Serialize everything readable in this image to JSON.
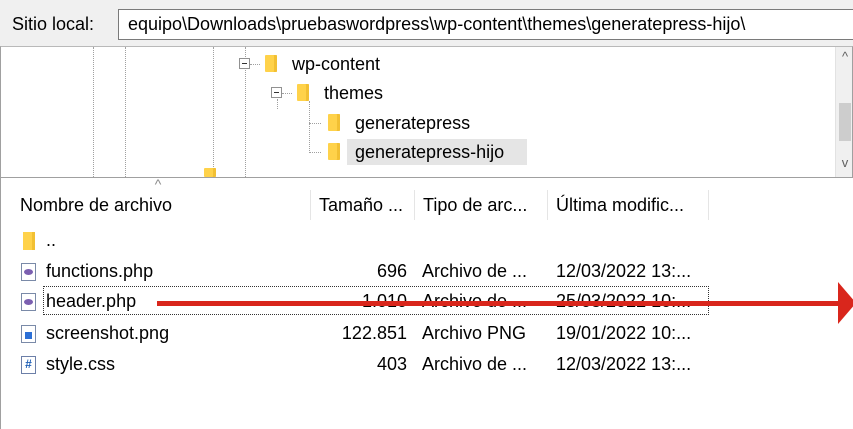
{
  "path_bar": {
    "label": "Sitio local:",
    "value": "equipo\\Downloads\\pruebaswordpress\\wp-content\\themes\\generatepress-hijo\\"
  },
  "tree": {
    "nodes": [
      {
        "label": "wp-content",
        "state": "expanded"
      },
      {
        "label": "themes",
        "state": "expanded"
      },
      {
        "label": "generatepress",
        "state": "leaf"
      },
      {
        "label": "generatepress-hijo",
        "state": "selected"
      }
    ],
    "scroll_up": "^",
    "scroll_down": "v"
  },
  "file_list": {
    "columns": [
      "Nombre de archivo",
      "Tamaño ...",
      "Tipo de arc...",
      "Última modific..."
    ],
    "sort_indicator": "^",
    "rows": [
      {
        "name": "..",
        "size": "",
        "type": "",
        "modified": "",
        "icon": "folder-icon"
      },
      {
        "name": "functions.php",
        "size": "696",
        "type": "Archivo de ...",
        "modified": "12/03/2022 13:...",
        "icon": "php-file-icon"
      },
      {
        "name": "header.php",
        "size": "1.010",
        "type": "Archivo de ...",
        "modified": "25/03/2022 10:...",
        "icon": "php-file-icon"
      },
      {
        "name": "screenshot.png",
        "size": "122.851",
        "type": "Archivo PNG",
        "modified": "19/01/2022 10:...",
        "icon": "image-file-icon"
      },
      {
        "name": "style.css",
        "size": "403",
        "type": "Archivo de ...",
        "modified": "12/03/2022 13:...",
        "icon": "css-file-icon"
      }
    ]
  },
  "colors": {
    "annotation_arrow": "#d9261c",
    "folder": "#ffd24a",
    "selection": "#e5e5e5"
  }
}
